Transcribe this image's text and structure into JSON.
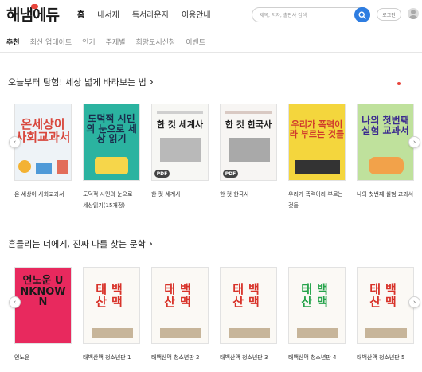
{
  "header": {
    "logo_text": "해냄에듀",
    "nav": [
      "홈",
      "내서재",
      "독서라운지",
      "이용안내"
    ],
    "search_placeholder": "제목, 저자, 출판사 검색",
    "login_label": "로그인"
  },
  "subtabs": [
    "추천",
    "최신 업데이트",
    "인기",
    "주제별",
    "희망도서신청",
    "이벤트"
  ],
  "section1": {
    "title": "오늘부터 탐험! 세상 넓게 바라보는 법",
    "books": [
      {
        "cover_text": "온세상이 사회교과서",
        "caption": "온 세상이 사회교과서"
      },
      {
        "cover_text": "도덕적 시민의 눈으로 세상 읽기",
        "caption": "도덕적 시민의 눈으로 세상읽기(15개정)"
      },
      {
        "cover_text": "한 컷 세계사",
        "caption": "한 컷 세계사",
        "badge": "PDF"
      },
      {
        "cover_text": "한 컷 한국사",
        "caption": "한 컷 한국사",
        "badge": "PDF"
      },
      {
        "cover_text": "우리가 폭력이라 부르는 것들",
        "caption": "우리가 폭력이라 부르는 것들"
      },
      {
        "cover_text": "나의 첫번째 실험 교과서",
        "caption": "나의 첫번째 실험 교과서"
      }
    ]
  },
  "section2": {
    "title": "흔들리는 너에게, 진짜 나를 찾는 문학",
    "books": [
      {
        "cover_text": "언노운 UNKNOWN",
        "caption": "언노운"
      },
      {
        "cover_text": "태백산맥",
        "caption": "태백산맥 청소년판 1"
      },
      {
        "cover_text": "태백산맥",
        "caption": "태백산맥 청소년판 2"
      },
      {
        "cover_text": "태백산맥",
        "caption": "태백산맥 청소년판 3"
      },
      {
        "cover_text": "태백산맥",
        "caption": "태백산맥 청소년판 4"
      },
      {
        "cover_text": "태백산맥",
        "caption": "태백산맥 청소년판 5"
      }
    ]
  },
  "colors": {
    "accent_blue": "#2e7de1",
    "accent_red": "#e8453c"
  }
}
